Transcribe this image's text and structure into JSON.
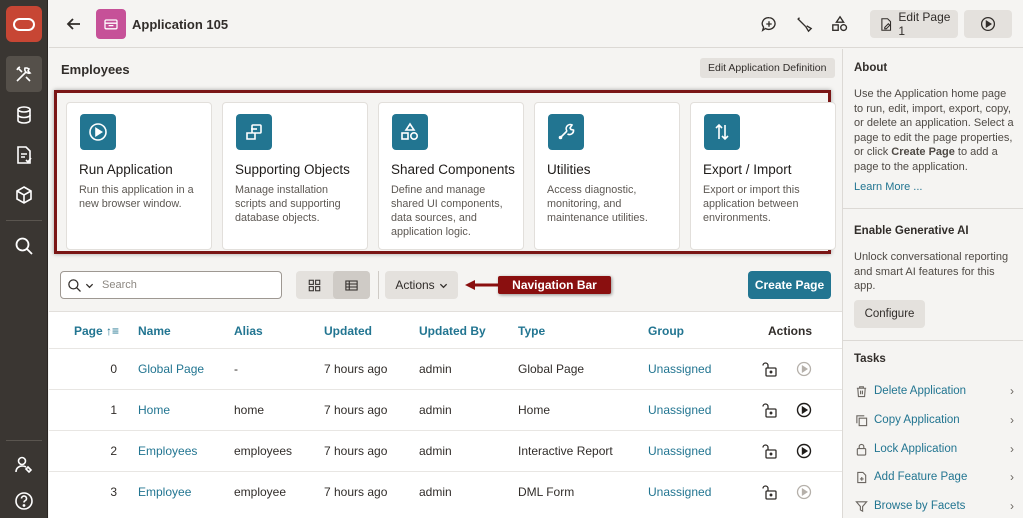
{
  "header": {
    "app_title": "Application 105",
    "edit_page_label": "Edit Page 1"
  },
  "main": {
    "page_title": "Employees",
    "edit_def_label": "Edit Application Definition",
    "cards": [
      {
        "title": "Run Application",
        "desc": "Run this application in a new browser window.",
        "icon": "play-icon"
      },
      {
        "title": "Supporting Objects",
        "desc": "Manage installation scripts and supporting database objects.",
        "icon": "supporting-objects-icon"
      },
      {
        "title": "Shared Components",
        "desc": "Define and manage shared UI components, data sources, and application logic.",
        "icon": "shapes-icon"
      },
      {
        "title": "Utilities",
        "desc": "Access diagnostic, monitoring, and maintenance utilities.",
        "icon": "wrench-icon"
      },
      {
        "title": "Export / Import",
        "desc": "Export or import this application between environments.",
        "icon": "export-import-icon"
      }
    ],
    "toolbar": {
      "search_placeholder": "Search",
      "actions_label": "Actions",
      "callout_label": "Navigation Bar",
      "create_label": "Create Page"
    },
    "table": {
      "headers": [
        "Page",
        "Name",
        "Alias",
        "Updated",
        "Updated By",
        "Type",
        "Group",
        "Actions"
      ],
      "rows": [
        {
          "page": "0",
          "name": "Global Page",
          "alias": "-",
          "updated": "7 hours ago",
          "by": "admin",
          "type": "Global Page",
          "group": "Unassigned",
          "run_enabled": false
        },
        {
          "page": "1",
          "name": "Home",
          "alias": "home",
          "updated": "7 hours ago",
          "by": "admin",
          "type": "Home",
          "group": "Unassigned",
          "run_enabled": true
        },
        {
          "page": "2",
          "name": "Employees",
          "alias": "employees",
          "updated": "7 hours ago",
          "by": "admin",
          "type": "Interactive Report",
          "group": "Unassigned",
          "run_enabled": true
        },
        {
          "page": "3",
          "name": "Employee",
          "alias": "employee",
          "updated": "7 hours ago",
          "by": "admin",
          "type": "DML Form",
          "group": "Unassigned",
          "run_enabled": false
        }
      ]
    }
  },
  "right_panel": {
    "about_title": "About",
    "about_text_1": "Use the Application home page to run, edit, import, export, copy, or delete an application. Select a page to edit the page properties, or click ",
    "about_bold": "Create Page",
    "about_text_2": " to add a page to the application.",
    "learn_more": "Learn More ...",
    "genai_title": "Enable Generative AI",
    "genai_text": "Unlock conversational reporting and smart AI features for this app.",
    "configure_label": "Configure",
    "tasks_title": "Tasks",
    "tasks": [
      {
        "label": "Delete Application",
        "icon": "trash-icon"
      },
      {
        "label": "Copy Application",
        "icon": "copy-icon"
      },
      {
        "label": "Lock Application",
        "icon": "lock-icon"
      },
      {
        "label": "Add Feature Page",
        "icon": "add-page-icon"
      },
      {
        "label": "Browse by Facets",
        "icon": "filter-icon"
      }
    ]
  },
  "colors": {
    "accent": "#227591",
    "app_icon": "#c65198",
    "callout": "#8a0f0f",
    "oracle_red": "#c74634"
  }
}
